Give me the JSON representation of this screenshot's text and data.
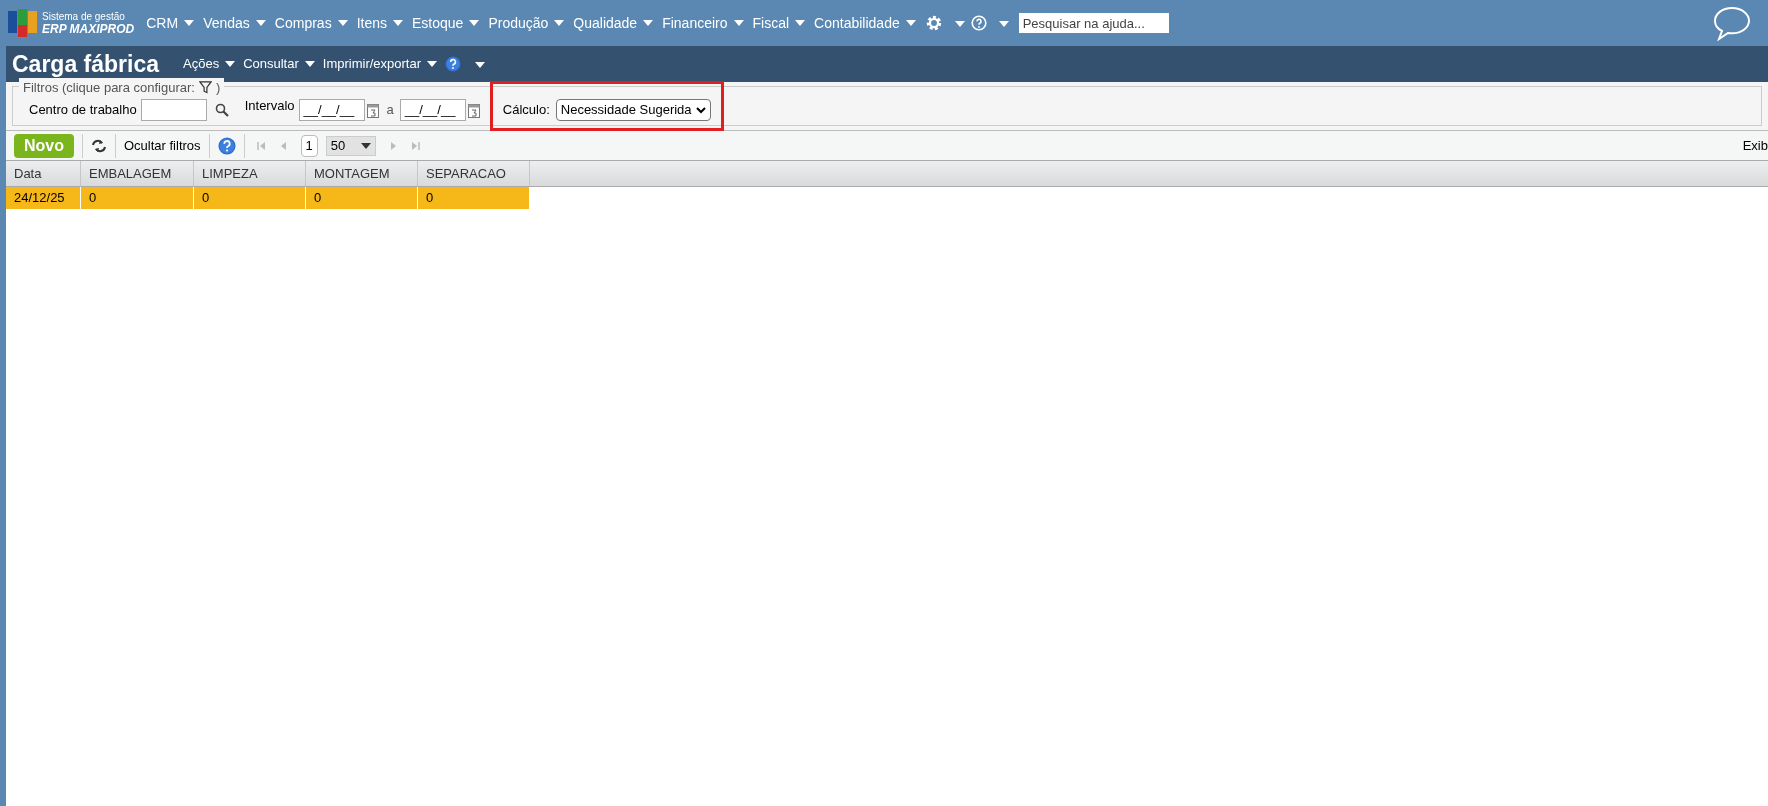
{
  "brand": {
    "line1": "Sistema de gestão",
    "line2": "ERP MAXIPROD"
  },
  "menu": [
    "CRM",
    "Vendas",
    "Compras",
    "Itens",
    "Estoque",
    "Produção",
    "Qualidade",
    "Financeiro",
    "Fiscal",
    "Contabilidade"
  ],
  "help_search": {
    "placeholder": "Pesquisar na ajuda..."
  },
  "page": {
    "title": "Carga fábrica",
    "actions": [
      "Ações",
      "Consultar",
      "Imprimir/exportar"
    ]
  },
  "filters": {
    "legend_start": "Filtros (clique para configurar:",
    "legend_end": ")",
    "work_center_label": "Centro de trabalho",
    "interval_label": "Intervalo",
    "date_from": "__/__/__",
    "between": "a",
    "date_to": "__/__/__",
    "calc_label": "Cálculo:",
    "calc_value": "Necessidade Sugerida",
    "calc_highlighted": true
  },
  "toolbar": {
    "new_button": "Novo",
    "hide_filters": "Ocultar filtros",
    "page": "1",
    "page_size": "50",
    "right_text": "Exib"
  },
  "table": {
    "columns": [
      "Data",
      "EMBALAGEM",
      "LIMPEZA",
      "MONTAGEM",
      "SEPARACAO"
    ],
    "rows": [
      {
        "cells": [
          "24/12/25",
          "0",
          "0",
          "0",
          "0"
        ],
        "selected": true
      }
    ]
  }
}
